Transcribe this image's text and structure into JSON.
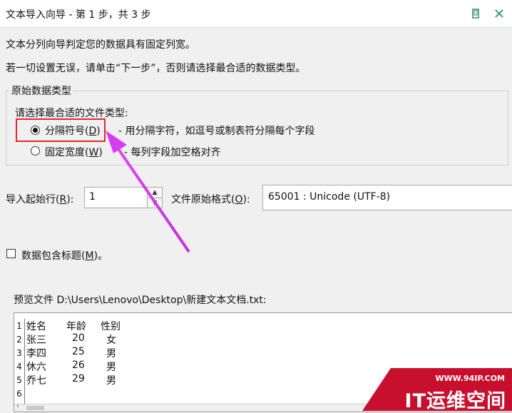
{
  "window": {
    "title": "文本导入向导 - 第 1 步，共 3 步",
    "buttons": [
      "restore-icon",
      "close-icon"
    ]
  },
  "intro": {
    "line1": "文本分列向导判定您的数据具有固定列宽。",
    "line2": "若一切设置无误，请单击“下一步”，否则请选择最合适的数据类型。"
  },
  "original_type": {
    "group_label": "原始数据类型",
    "prompt": "请选择最合适的文件类型:",
    "options": [
      {
        "label": "分隔符号",
        "hotkey": "D",
        "desc": "- 用分隔字符，如逗号或制表符分隔每个字段",
        "checked": true
      },
      {
        "label": "固定宽度",
        "hotkey": "W",
        "desc": "- 每列字段加空格对齐",
        "checked": false
      }
    ]
  },
  "start_row": {
    "label": "导入起始行",
    "hotkey": "R",
    "value": "1"
  },
  "file_origin": {
    "label": "文件原始格式",
    "hotkey": "O",
    "value": "65001 : Unicode (UTF-8)"
  },
  "headers_check": {
    "label": "数据包含标题",
    "hotkey": "M",
    "suffix": "。",
    "checked": false
  },
  "preview": {
    "label": "预览文件 D:\\Users\\Lenovo\\Desktop\\新建文本文档.txt:",
    "rows": [
      {
        "num": "1",
        "cols": [
          "姓名",
          "年龄",
          "性别"
        ]
      },
      {
        "num": "2",
        "cols": [
          "张三",
          "20",
          "女"
        ]
      },
      {
        "num": "3",
        "cols": [
          "李四",
          "25",
          "男"
        ]
      },
      {
        "num": "4",
        "cols": [
          "休六",
          "26",
          "男"
        ]
      },
      {
        "num": "5",
        "cols": [
          "乔七",
          "29",
          "男"
        ]
      },
      {
        "num": "6",
        "cols": [
          "",
          "",
          ""
        ]
      }
    ]
  },
  "watermark": {
    "url": "WWW.94IP.COM",
    "logo": "IT运维空间"
  },
  "colors": {
    "highlight": "#e02a2a",
    "arrow": "#d63cf0",
    "watermark_bg": "#c8102e"
  }
}
